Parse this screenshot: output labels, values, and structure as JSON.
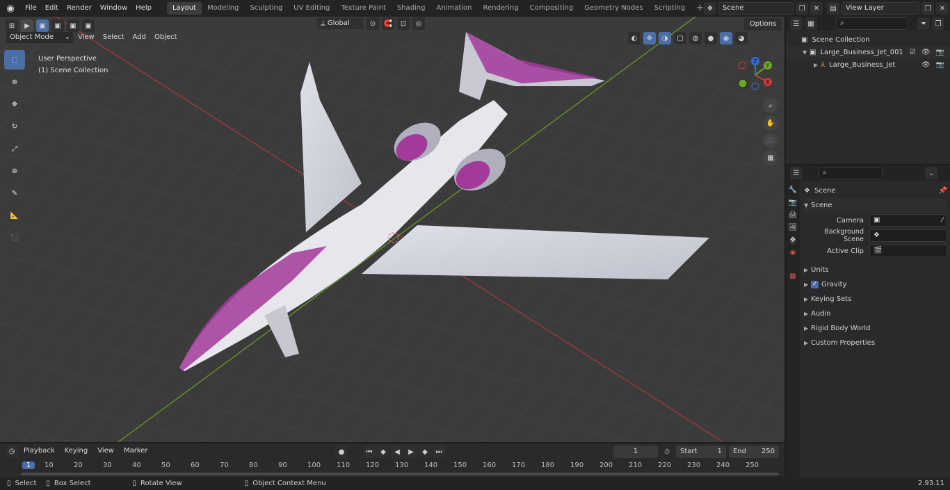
{
  "topbar": {
    "menus": [
      "File",
      "Edit",
      "Render",
      "Window",
      "Help"
    ],
    "workspaces": [
      "Layout",
      "Modeling",
      "Sculpting",
      "UV Editing",
      "Texture Paint",
      "Shading",
      "Animation",
      "Rendering",
      "Compositing",
      "Geometry Nodes",
      "Scripting"
    ],
    "active_workspace": "Layout",
    "scene_name": "Scene",
    "view_layer": "View Layer"
  },
  "viewport": {
    "mode": "Object Mode",
    "menus": [
      "View",
      "Select",
      "Add",
      "Object"
    ],
    "transform_orientation": "Global",
    "options_label": "Options",
    "overlay_title": "User Perspective",
    "overlay_sub": "(1) Scene Collection",
    "gizmo": {
      "z": "Z",
      "y": "Y",
      "x": "X"
    }
  },
  "outliner": {
    "root": "Scene Collection",
    "items": [
      {
        "name": "Large_Business_Jet_001",
        "level": 1
      },
      {
        "name": "Large_Business_Jet",
        "level": 2
      }
    ]
  },
  "properties": {
    "context": "Scene",
    "section": "Scene",
    "fields": [
      {
        "label": "Camera",
        "value": ""
      },
      {
        "label": "Background Scene",
        "value": ""
      },
      {
        "label": "Active Clip",
        "value": ""
      }
    ],
    "panels": [
      "Units",
      "Gravity",
      "Keying Sets",
      "Audio",
      "Rigid Body World",
      "Custom Properties"
    ]
  },
  "timeline": {
    "menus": [
      "Playback",
      "Keying",
      "View",
      "Marker"
    ],
    "current_frame": "1",
    "start_label": "Start",
    "start": "1",
    "end_label": "End",
    "end": "250",
    "ruler": [
      "1",
      "10",
      "20",
      "30",
      "40",
      "50",
      "60",
      "70",
      "80",
      "90",
      "100",
      "110",
      "120",
      "130",
      "140",
      "150",
      "160",
      "170",
      "180",
      "190",
      "200",
      "210",
      "220",
      "230",
      "240",
      "250"
    ]
  },
  "status": {
    "items": [
      "Select",
      "Box Select",
      "Rotate View",
      "Object Context Menu"
    ],
    "version": "2.93.11"
  },
  "colors": {
    "accent": "#4a6ea8",
    "jet_purple": "#a23a9a",
    "grid_red": "#a43a3a",
    "grid_green": "#6a9a2a"
  }
}
